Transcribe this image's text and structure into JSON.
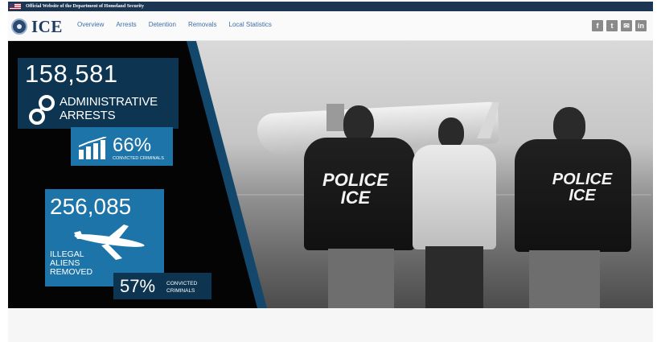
{
  "gov_banner": {
    "text": "Official Website of the Department of Homeland Security"
  },
  "header": {
    "logo_text": "ICE",
    "nav": [
      "Overview",
      "Arrests",
      "Detention",
      "Removals",
      "Local Statistics"
    ],
    "social": [
      {
        "icon": "facebook-icon",
        "glyph": "f"
      },
      {
        "icon": "twitter-icon",
        "glyph": "t"
      },
      {
        "icon": "email-icon",
        "glyph": "✉"
      },
      {
        "icon": "linkedin-icon",
        "glyph": "in"
      }
    ]
  },
  "hero": {
    "arrests": {
      "number": "158,581",
      "label_line1": "ADMINISTRATIVE",
      "label_line2": "ARRESTS",
      "percent": "66%",
      "percent_caption": "CONVICTED CRIMINALS"
    },
    "removals": {
      "number": "256,085",
      "label_line1": "ILLEGAL",
      "label_line2": "ALIENS",
      "label_line3": "REMOVED",
      "percent": "57%",
      "percent_caption_line1": "CONVICTED",
      "percent_caption_line2": "CRIMINALS"
    },
    "jacket_left": {
      "line1": "POLICE",
      "line2": "ICE"
    },
    "jacket_right": {
      "line1": "POLICE",
      "line2": "ICE"
    }
  },
  "colors": {
    "dark_panel": "#0d3551",
    "light_panel": "#1d74a9",
    "nav_link": "#3e6fa8",
    "banner": "#1c3553"
  }
}
